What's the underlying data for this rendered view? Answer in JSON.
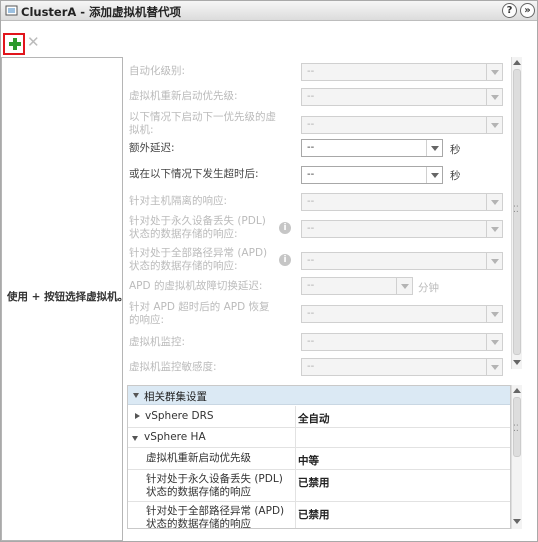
{
  "window": {
    "title": "ClusterA - 添加虚拟机替代项",
    "help_label": "?",
    "menu_label": "»"
  },
  "vm_list": {
    "empty_message": "使用 + 按钮选择虚拟机。"
  },
  "form": {
    "rows": [
      {
        "label": "自动化级别:",
        "value": "--"
      },
      {
        "label": "虚拟机重新启动优先级:",
        "value": "--"
      },
      {
        "label": "以下情况下启动下一优先级的虚拟机:",
        "value": "--"
      },
      {
        "label": "额外延迟:",
        "value": "--",
        "unit": "秒"
      },
      {
        "label": "或在以下情况下发生超时后:",
        "value": "--",
        "unit": "秒"
      },
      {
        "label": "针对主机隔离的响应:",
        "value": "--"
      },
      {
        "label": "针对处于永久设备丢失 (PDL) 状态的数据存储的响应:",
        "value": "--"
      },
      {
        "label": "针对处于全部路径异常 (APD) 状态的数据存储的响应:",
        "value": "--"
      },
      {
        "label": "APD 的虚拟机故障切换延迟:",
        "value": "--",
        "unit": "分钟"
      },
      {
        "label": "针对 APD 超时后的 APD 恢复的响应:",
        "value": "--"
      },
      {
        "label": "虚拟机监控:",
        "value": "--"
      },
      {
        "label": "虚拟机监控敏感度:",
        "value": "--"
      }
    ]
  },
  "related": {
    "header": "相关群集设置",
    "drs": {
      "label": "vSphere DRS",
      "value": "全自动"
    },
    "ha": {
      "label": "vSphere HA"
    },
    "rows": [
      {
        "label": "虚拟机重新启动优先级",
        "value": "中等"
      },
      {
        "label": "针对处于永久设备丢失 (PDL) 状态的数据存储的响应",
        "value": "已禁用"
      },
      {
        "label": "针对处于全部路径异常 (APD) 状态的数据存储的响应",
        "value": "已禁用"
      }
    ]
  },
  "colors": {
    "add": "#2d9a2d",
    "highlight": "#e1151c",
    "header_bg": "#dbe9f4"
  },
  "icons": {
    "title": "vm-override-icon",
    "add": "add-icon",
    "delete": "delete-icon",
    "info": "info-icon"
  }
}
